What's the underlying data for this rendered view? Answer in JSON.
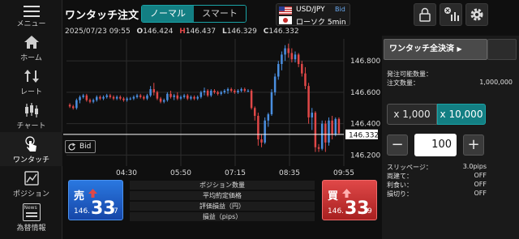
{
  "sidebar": {
    "menu_label": "メニュー",
    "items": [
      {
        "label": "ホーム",
        "icon": "home-icon"
      },
      {
        "label": "レート",
        "icon": "rate-icon"
      },
      {
        "label": "チャート",
        "icon": "candlestick-icon"
      },
      {
        "label": "ワンタッチ",
        "icon": "touch-icon"
      },
      {
        "label": "ポジション",
        "icon": "position-icon"
      },
      {
        "label": "為替情報",
        "icon": "news-icon"
      }
    ],
    "news_badge": "News"
  },
  "header": {
    "title": "ワンタッチ注文",
    "mode_normal": "ノーマル",
    "mode_smart": "スマート",
    "pair": "USD/JPY",
    "price_side": "Bid",
    "candle_type": "ローソク 5min",
    "accent_color": "#137f83"
  },
  "ohlc": {
    "datetime": "2025/07/23 09:55",
    "o_key": "O",
    "o": "146.424",
    "h_key": "H",
    "h": "146.437",
    "l_key": "L",
    "l": "146.329",
    "c_key": "C",
    "c": "146.332"
  },
  "chart_data": {
    "type": "candlestick",
    "x_tick_labels": [
      "04:30",
      "05:50",
      "07:15",
      "08:35",
      "09:55"
    ],
    "y_tick_labels": [
      "146.800",
      "146.600",
      "146.400",
      "146.200"
    ],
    "ylim": [
      146.13,
      146.94
    ],
    "current_price": "146.332",
    "current_value": 146.332,
    "bid_label": "Bid",
    "up_color": "#4a8fe0",
    "down_color": "#e04848",
    "candles": [
      [
        146.52,
        146.53,
        146.5,
        146.51
      ],
      [
        146.51,
        146.52,
        146.49,
        146.5
      ],
      [
        146.5,
        146.56,
        146.49,
        146.55
      ],
      [
        146.55,
        146.58,
        146.53,
        146.57
      ],
      [
        146.57,
        146.59,
        146.56,
        146.58
      ],
      [
        146.58,
        146.59,
        146.54,
        146.55
      ],
      [
        146.55,
        146.56,
        146.53,
        146.54
      ],
      [
        146.54,
        146.56,
        146.53,
        146.55
      ],
      [
        146.55,
        146.58,
        146.54,
        146.57
      ],
      [
        146.57,
        146.58,
        146.55,
        146.56
      ],
      [
        146.56,
        146.58,
        146.55,
        146.57
      ],
      [
        146.57,
        146.59,
        146.56,
        146.58
      ],
      [
        146.58,
        146.59,
        146.56,
        146.57
      ],
      [
        146.57,
        146.58,
        146.55,
        146.56
      ],
      [
        146.56,
        146.58,
        146.55,
        146.57
      ],
      [
        146.57,
        146.58,
        146.55,
        146.56
      ],
      [
        146.56,
        146.57,
        146.54,
        146.55
      ],
      [
        146.55,
        146.57,
        146.54,
        146.56
      ],
      [
        146.56,
        146.57,
        146.55,
        146.56
      ],
      [
        146.56,
        146.58,
        146.55,
        146.57
      ],
      [
        146.57,
        146.59,
        146.56,
        146.58
      ],
      [
        146.58,
        146.59,
        146.56,
        146.57
      ],
      [
        146.57,
        146.58,
        146.55,
        146.56
      ],
      [
        146.56,
        146.59,
        146.55,
        146.58
      ],
      [
        146.58,
        146.64,
        146.57,
        146.62
      ],
      [
        146.62,
        146.66,
        146.58,
        146.6
      ],
      [
        146.6,
        146.61,
        146.55,
        146.56
      ],
      [
        146.56,
        146.57,
        146.53,
        146.54
      ],
      [
        146.54,
        146.56,
        146.53,
        146.55
      ],
      [
        146.55,
        146.6,
        146.54,
        146.59
      ],
      [
        146.59,
        146.61,
        146.56,
        146.57
      ],
      [
        146.57,
        146.59,
        146.55,
        146.58
      ],
      [
        146.58,
        146.6,
        146.55,
        146.56
      ],
      [
        146.56,
        146.58,
        146.55,
        146.57
      ],
      [
        146.57,
        146.59,
        146.56,
        146.58
      ],
      [
        146.58,
        146.59,
        146.55,
        146.56
      ],
      [
        146.56,
        146.58,
        146.55,
        146.57
      ],
      [
        146.57,
        146.58,
        146.55,
        146.56
      ],
      [
        146.56,
        146.58,
        146.55,
        146.57
      ],
      [
        146.57,
        146.61,
        146.56,
        146.6
      ],
      [
        146.6,
        146.63,
        146.58,
        146.61
      ],
      [
        146.61,
        146.62,
        146.57,
        146.58
      ],
      [
        146.58,
        146.62,
        146.57,
        146.61
      ],
      [
        146.61,
        146.62,
        146.59,
        146.6
      ],
      [
        146.6,
        146.61,
        146.58,
        146.59
      ],
      [
        146.59,
        146.61,
        146.58,
        146.6
      ],
      [
        146.6,
        146.62,
        146.59,
        146.61
      ],
      [
        146.61,
        146.63,
        146.59,
        146.62
      ],
      [
        146.62,
        146.63,
        146.6,
        146.61
      ],
      [
        146.61,
        146.62,
        146.59,
        146.6
      ],
      [
        146.6,
        146.62,
        146.59,
        146.61
      ],
      [
        146.61,
        146.63,
        146.6,
        146.62
      ],
      [
        146.62,
        146.63,
        146.6,
        146.61
      ],
      [
        146.61,
        146.62,
        146.6,
        146.61
      ],
      [
        146.61,
        146.62,
        146.49,
        146.5
      ],
      [
        146.5,
        146.51,
        146.42,
        146.45
      ],
      [
        146.45,
        146.47,
        146.26,
        146.3
      ],
      [
        146.3,
        146.33,
        146.25,
        146.28
      ],
      [
        146.28,
        146.44,
        146.27,
        146.42
      ],
      [
        146.42,
        146.47,
        146.38,
        146.46
      ],
      [
        146.46,
        146.62,
        146.45,
        146.6
      ],
      [
        146.6,
        146.72,
        146.58,
        146.7
      ],
      [
        146.7,
        146.8,
        146.68,
        146.78
      ],
      [
        146.78,
        146.86,
        146.74,
        146.84
      ],
      [
        146.84,
        146.9,
        146.8,
        146.88
      ],
      [
        146.88,
        146.91,
        146.82,
        146.85
      ],
      [
        146.85,
        146.88,
        146.79,
        146.81
      ],
      [
        146.81,
        146.86,
        146.79,
        146.84
      ],
      [
        146.84,
        146.85,
        146.76,
        146.78
      ],
      [
        146.78,
        146.8,
        146.7,
        146.72
      ],
      [
        146.72,
        146.76,
        146.62,
        146.64
      ],
      [
        146.64,
        146.66,
        146.4,
        146.44
      ],
      [
        146.44,
        146.5,
        146.36,
        146.47
      ],
      [
        146.47,
        146.48,
        146.22,
        146.25
      ],
      [
        146.25,
        146.27,
        146.22,
        146.24
      ],
      [
        146.24,
        146.42,
        146.23,
        146.4
      ],
      [
        146.4,
        146.42,
        146.22,
        146.28
      ],
      [
        146.28,
        146.44,
        146.26,
        146.42
      ],
      [
        146.42,
        146.45,
        146.3,
        146.33
      ],
      [
        146.33,
        146.44,
        146.32,
        146.43
      ],
      [
        146.43,
        146.44,
        146.33,
        146.34
      ]
    ]
  },
  "right_panel": {
    "close_all_label": "ワンタッチ全決済",
    "orderable_label": "発注可能数量：",
    "order_qty_label": "注文数量：",
    "order_qty_value": "1,000,000",
    "lot_1000": "x 1,000",
    "lot_10000": "x 10,000",
    "qty_value": "100",
    "minus": "−",
    "plus": "+",
    "slippage_label": "スリッページ：",
    "slippage_value": "3.0pips",
    "both_label": "両建て：",
    "both_value": "OFF",
    "take_profit_label": "利食い：",
    "take_profit_value": "OFF",
    "stop_loss_label": "損切り：",
    "stop_loss_value": "OFF"
  },
  "sell": {
    "label": "売",
    "price_small": "146.",
    "price_big": "33",
    "price_tail": "7",
    "color": "#1d5fc4"
  },
  "buy": {
    "label": "買",
    "price_small": "146.",
    "price_big": "33",
    "price_tail": "9",
    "color": "#d83a3a"
  },
  "bottom_rows": [
    "ポジション数量",
    "平均約定価格",
    "評価損益（円）",
    "損益（pips）"
  ]
}
